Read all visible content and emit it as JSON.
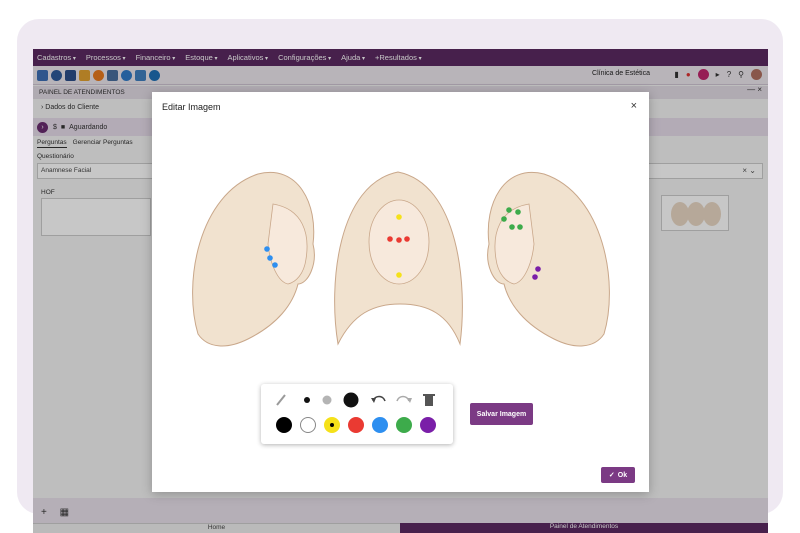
{
  "menu": [
    "Cadastros",
    "Processos",
    "Financeiro",
    "Estoque",
    "Aplicativos",
    "Configurações",
    "Ajuda",
    "+Resultados"
  ],
  "toolbar": {
    "clinic_name": "Clínica de Estética",
    "icons": [
      "book-icon",
      "globe-icon",
      "card-icon",
      "card2-icon",
      "clock-icon",
      "calendar-icon",
      "chat-icon",
      "users-icon",
      "search-sync-icon"
    ]
  },
  "panel": {
    "title": "PAINEL DE ATENDIMENTOS",
    "client_label": "Dados do Cliente",
    "status_prefix": "$",
    "status_label": "Aguardando",
    "tabs": [
      "Perguntas",
      "Gerenciar Perguntas"
    ],
    "questionnaire_label": "Questionário",
    "questionnaire_value": "Anamnese Facial",
    "hof_label": "HOF"
  },
  "bottom": {
    "tab_home": "Home",
    "tab_painel": "Painel de Atendimentos"
  },
  "modal": {
    "title": "Editar Imagem",
    "save_label": "Salvar Imagem",
    "ok_label": "Ok"
  },
  "palette": {
    "sizes": [
      "small",
      "medium",
      "large"
    ],
    "colors": [
      "#000000",
      "#ffffff",
      "#f5e11a",
      "#ea3a32",
      "#2e8ff0",
      "#3dab4b",
      "#7a1fa8"
    ],
    "selected_color": "#f5e11a"
  },
  "colors": {
    "brand": "#5b2a62",
    "accent": "#7b3a84"
  }
}
